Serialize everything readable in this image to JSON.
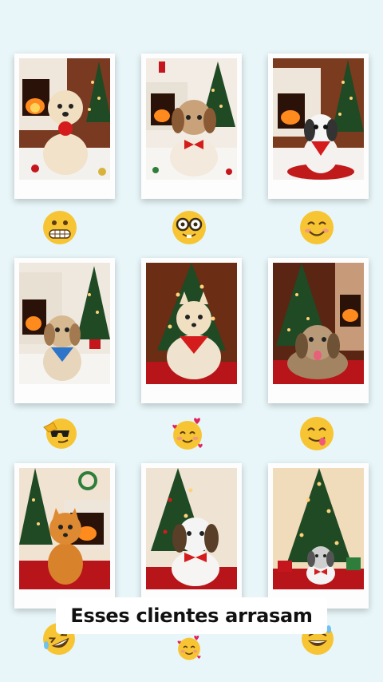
{
  "caption": {
    "text": "Esses clientes arrasam"
  },
  "photos": [
    {
      "icon": "pomeranian-red-bow-fireplace-photo"
    },
    {
      "icon": "shih-tzu-red-bowtie-fireplace-photo"
    },
    {
      "icon": "shih-tzu-bandana-fireplace-photo"
    },
    {
      "icon": "shih-tzu-blue-bandana-fireplace-photo"
    },
    {
      "icon": "pomeranian-red-bandana-tree-photo"
    },
    {
      "icon": "shih-tzu-tongue-out-tree-photo"
    },
    {
      "icon": "orange-pomeranian-fireplace-photo"
    },
    {
      "icon": "shih-tzu-red-bowtie-tree-photo"
    },
    {
      "icon": "shih-tzu-red-bowtie-gifts-photo"
    }
  ],
  "emojis": [
    "grimacing-face-icon",
    "nerd-face-icon",
    "smiling-face-icon",
    "saluting-sunglasses-face-icon",
    "smiling-face-with-hearts-icon",
    "face-savoring-food-icon",
    "rolling-on-floor-laughing-icon",
    "smiling-face-with-hearts-icon",
    "grinning-sweat-face-icon"
  ]
}
